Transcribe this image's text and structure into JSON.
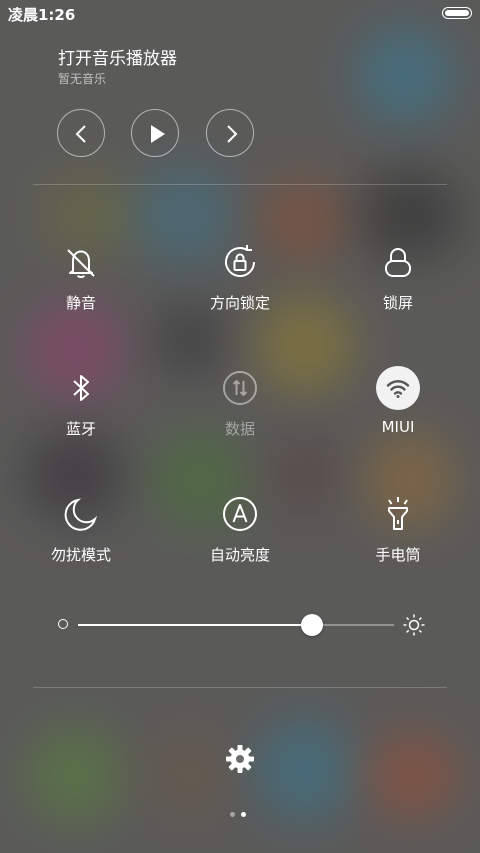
{
  "status_bar": {
    "time": "凌晨1:26"
  },
  "music": {
    "title": "打开音乐播放器",
    "subtitle": "暂无音乐"
  },
  "toggles": [
    {
      "label": "静音",
      "icon": "bell-off-icon",
      "active": false,
      "enabled": true
    },
    {
      "label": "方向锁定",
      "icon": "rotation-lock-icon",
      "active": false,
      "enabled": true
    },
    {
      "label": "锁屏",
      "icon": "lock-icon",
      "active": false,
      "enabled": true
    },
    {
      "label": "蓝牙",
      "icon": "bluetooth-icon",
      "active": false,
      "enabled": true
    },
    {
      "label": "数据",
      "icon": "mobile-data-icon",
      "active": false,
      "enabled": false
    },
    {
      "label": "MIUI",
      "icon": "wifi-icon",
      "active": true,
      "enabled": true
    },
    {
      "label": "勿扰模式",
      "icon": "moon-icon",
      "active": false,
      "enabled": true
    },
    {
      "label": "自动亮度",
      "icon": "auto-brightness-icon",
      "active": false,
      "enabled": true
    },
    {
      "label": "手电筒",
      "icon": "flashlight-icon",
      "active": false,
      "enabled": true
    }
  ],
  "brightness": {
    "level": 0.74
  },
  "pager": {
    "pages": 2,
    "current": 1
  },
  "colors": {
    "accent": "#ffffff",
    "active_bg": "#f2f2f2",
    "active_icon": "#555555"
  }
}
